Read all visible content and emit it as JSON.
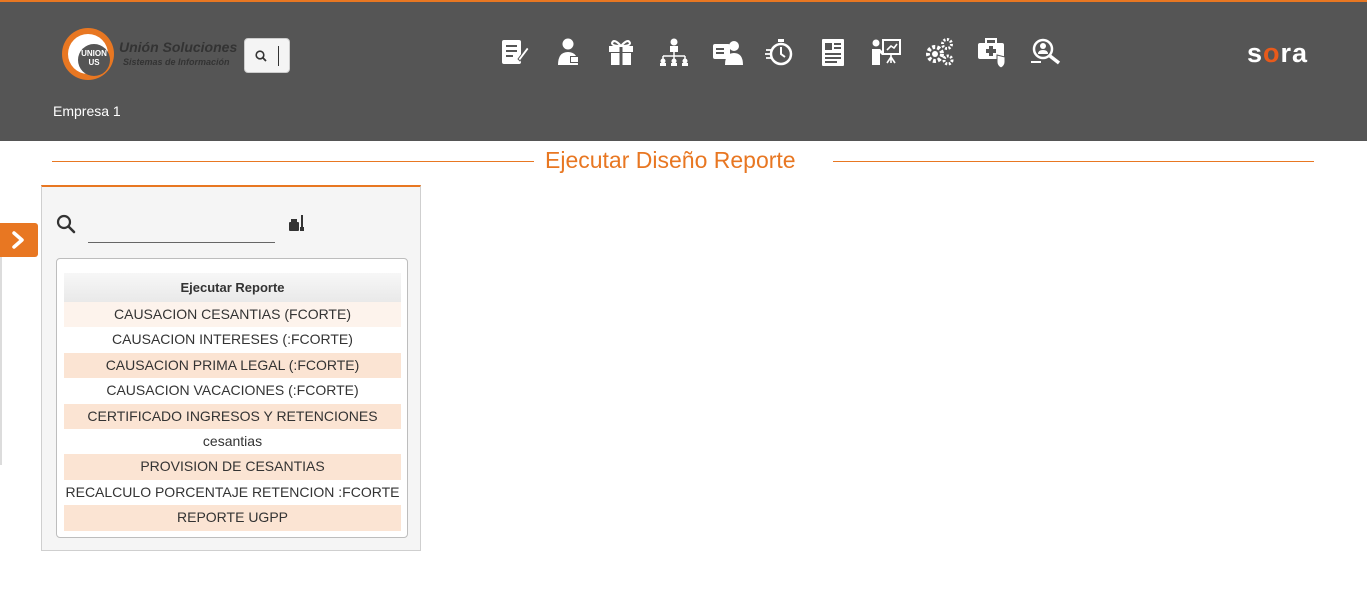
{
  "header": {
    "logo_title": "Unión Soluciones",
    "logo_subtitle": "Sistemas de Información",
    "logo_mark": "UNION US",
    "brand": {
      "prefix": "s",
      "accent": "o",
      "suffix": "ra"
    },
    "company": "Empresa 1",
    "nav_icons": [
      "edit-document-icon",
      "employee-icon",
      "gift-icon",
      "org-chart-icon",
      "id-card-user-icon",
      "stopwatch-icon",
      "report-document-icon",
      "presentation-icon",
      "gears-icon",
      "medical-kit-shield-icon",
      "user-search-icon"
    ]
  },
  "page": {
    "title": "Ejecutar Diseño Reporte"
  },
  "panel": {
    "search_value": "",
    "grid": {
      "header": "Ejecutar Reporte",
      "rows": [
        "CAUSACION CESANTIAS (FCORTE)",
        "CAUSACION INTERESES (:FCORTE)",
        "CAUSACION PRIMA LEGAL (:FCORTE)",
        "CAUSACION VACACIONES (:FCORTE)",
        "CERTIFICADO INGRESOS Y RETENCIONES",
        "cesantias",
        "PROVISION DE CESANTIAS",
        "RECALCULO PORCENTAJE RETENCION :FCORTE",
        "REPORTE UGPP"
      ]
    }
  },
  "colors": {
    "accent": "#e87722",
    "header_bg": "#555555",
    "row_highlight": "#fbe4d3"
  }
}
